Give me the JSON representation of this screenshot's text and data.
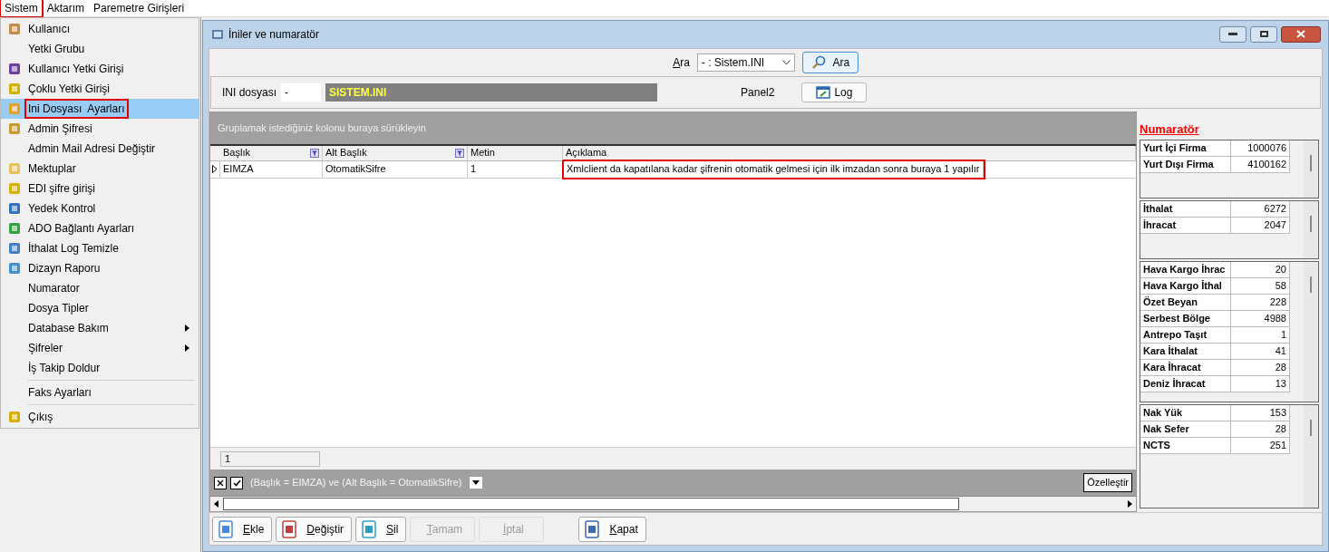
{
  "menu_bar": [
    {
      "label": "Sistem",
      "selected": true
    },
    {
      "label": "Aktarım",
      "selected": false
    },
    {
      "label": "Paremetre Girişleri",
      "selected": false
    }
  ],
  "menu": [
    {
      "kind": "icon",
      "label": "Kullanıcı",
      "selected": false
    },
    {
      "kind": "plain",
      "label": "Yetki Grubu",
      "selected": false
    },
    {
      "kind": "icon",
      "label": "Kullanıcı Yetki Girişi",
      "selected": false
    },
    {
      "kind": "icon",
      "label": "Çoklu Yetki Girişi",
      "selected": false
    },
    {
      "kind": "icon",
      "label": "Ini Dosyası  Ayarları",
      "selected": true
    },
    {
      "kind": "icon",
      "label": "Admin Şifresi",
      "selected": false
    },
    {
      "kind": "plain",
      "label": "Admin Mail Adresi Değiştir",
      "selected": false
    },
    {
      "kind": "icon",
      "label": "Mektuplar",
      "selected": false
    },
    {
      "kind": "icon",
      "label": "EDI şifre girişi",
      "selected": false
    },
    {
      "kind": "icon",
      "label": "Yedek Kontrol",
      "selected": false
    },
    {
      "kind": "icon",
      "label": "ADO Bağlantı Ayarları",
      "selected": false
    },
    {
      "kind": "icon",
      "label": "İthalat Log Temizle",
      "selected": false
    },
    {
      "kind": "icon",
      "label": "Dizayn Raporu",
      "selected": false
    },
    {
      "kind": "plain",
      "label": "Numarator",
      "selected": false
    },
    {
      "kind": "plain",
      "label": "Dosya Tipler",
      "selected": false
    },
    {
      "kind": "submenu",
      "label": "Database Bakım",
      "selected": false
    },
    {
      "kind": "submenu",
      "label": "Şifreler",
      "selected": false
    },
    {
      "kind": "plain",
      "label": "İş Takip Doldur",
      "selected": false
    },
    {
      "kind": "separator"
    },
    {
      "kind": "plain",
      "label": "Faks Ayarları",
      "selected": false
    },
    {
      "kind": "separator"
    },
    {
      "kind": "icon",
      "label": "Çıkış",
      "selected": false
    }
  ],
  "window": {
    "title": "İniler ve numaratör"
  },
  "search": {
    "label": "Ara",
    "value": "- : Sistem.INI",
    "button": "Ara"
  },
  "ini": {
    "label": "INI dosyası",
    "code": "-",
    "file": "SISTEM.INI",
    "panel_label": "Panel2",
    "log_button": "Log"
  },
  "grid": {
    "group_hint": "Gruplamak istediğiniz kolonu buraya sürükleyin",
    "columns": [
      {
        "label": "Başlık",
        "filtered": true
      },
      {
        "label": "Alt Başlık",
        "filtered": true
      },
      {
        "label": "Metin",
        "filtered": false
      },
      {
        "label": "Açıklama",
        "filtered": false
      }
    ],
    "rows": [
      {
        "selected": true,
        "cells": [
          "EIMZA",
          "OtomatikSifre",
          "1",
          "Xmlclient da kapatılana kadar şifrenin otomatik gelmesi için ilk imzadan sonra buraya 1 yapılır"
        ]
      }
    ],
    "footer": "1",
    "filter_text": "(Başlık = EIMZA) ve (Alt Başlık = OtomatikSifre)",
    "filter_enabled": true,
    "customize_button": "Özelleştir"
  },
  "buttons": [
    {
      "label": "Ekle",
      "disabled": false
    },
    {
      "label": "Değiştir",
      "disabled": false
    },
    {
      "label": "Sil",
      "disabled": false
    },
    {
      "label": "Tamam",
      "disabled": true
    },
    {
      "label": "İptal",
      "disabled": true
    },
    {
      "label": "Kapat",
      "disabled": false
    }
  ],
  "numerator": {
    "title": "Numaratör",
    "groups": [
      [
        {
          "label": "Yurt İçi Firma",
          "value": "1000076"
        },
        {
          "label": "Yurt Dışı Firma",
          "value": "4100162"
        }
      ],
      [
        {
          "label": "İthalat",
          "value": "6272"
        },
        {
          "label": "İhracat",
          "value": "2047"
        }
      ],
      [
        {
          "label": "Hava Kargo İhrac",
          "value": "20"
        },
        {
          "label": "Hava Kargo İthal",
          "value": "58"
        },
        {
          "label": "Özet Beyan",
          "value": "228"
        },
        {
          "label": "Serbest Bölge",
          "value": "4988"
        },
        {
          "label": "Antrepo Taşıt",
          "value": "1"
        },
        {
          "label": "Kara İthalat",
          "value": "41"
        },
        {
          "label": "Kara İhracat",
          "value": "28"
        },
        {
          "label": "Deniz İhracat",
          "value": "13"
        }
      ],
      [
        {
          "label": "Nak Yük",
          "value": "153"
        },
        {
          "label": "Nak Sefer",
          "value": "28"
        },
        {
          "label": "NCTS",
          "value": "251"
        }
      ]
    ]
  }
}
